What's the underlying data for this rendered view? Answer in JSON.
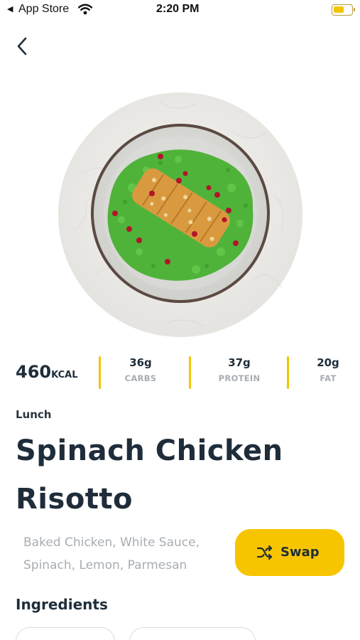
{
  "status_bar": {
    "back_label": "App Store",
    "time": "2:20 PM",
    "battery_level": 0.55,
    "battery_color": "#f5c400"
  },
  "nav": {
    "back_icon": "chevron-left-icon"
  },
  "dish": {
    "image_icon": "dish-image"
  },
  "macros": {
    "kcal_value": "460",
    "kcal_unit": "KCAL",
    "carbs_value": "36g",
    "carbs_label": "CARBS",
    "protein_value": "37g",
    "protein_label": "PROTEIN",
    "fat_value": "20g",
    "fat_label": "FAT",
    "divider_color": "#f5c400"
  },
  "meal": {
    "type": "Lunch",
    "title_line1": "Spinach Chicken",
    "title_line2": "Risotto",
    "description_line1": "Baked Chicken, White Sauce,",
    "description_line2": "Spinach, Lemon, Parmesan"
  },
  "swap": {
    "label": "Swap",
    "icon": "shuffle-icon",
    "color": "#f7c500"
  },
  "ingredients": {
    "title": "Ingredients"
  }
}
